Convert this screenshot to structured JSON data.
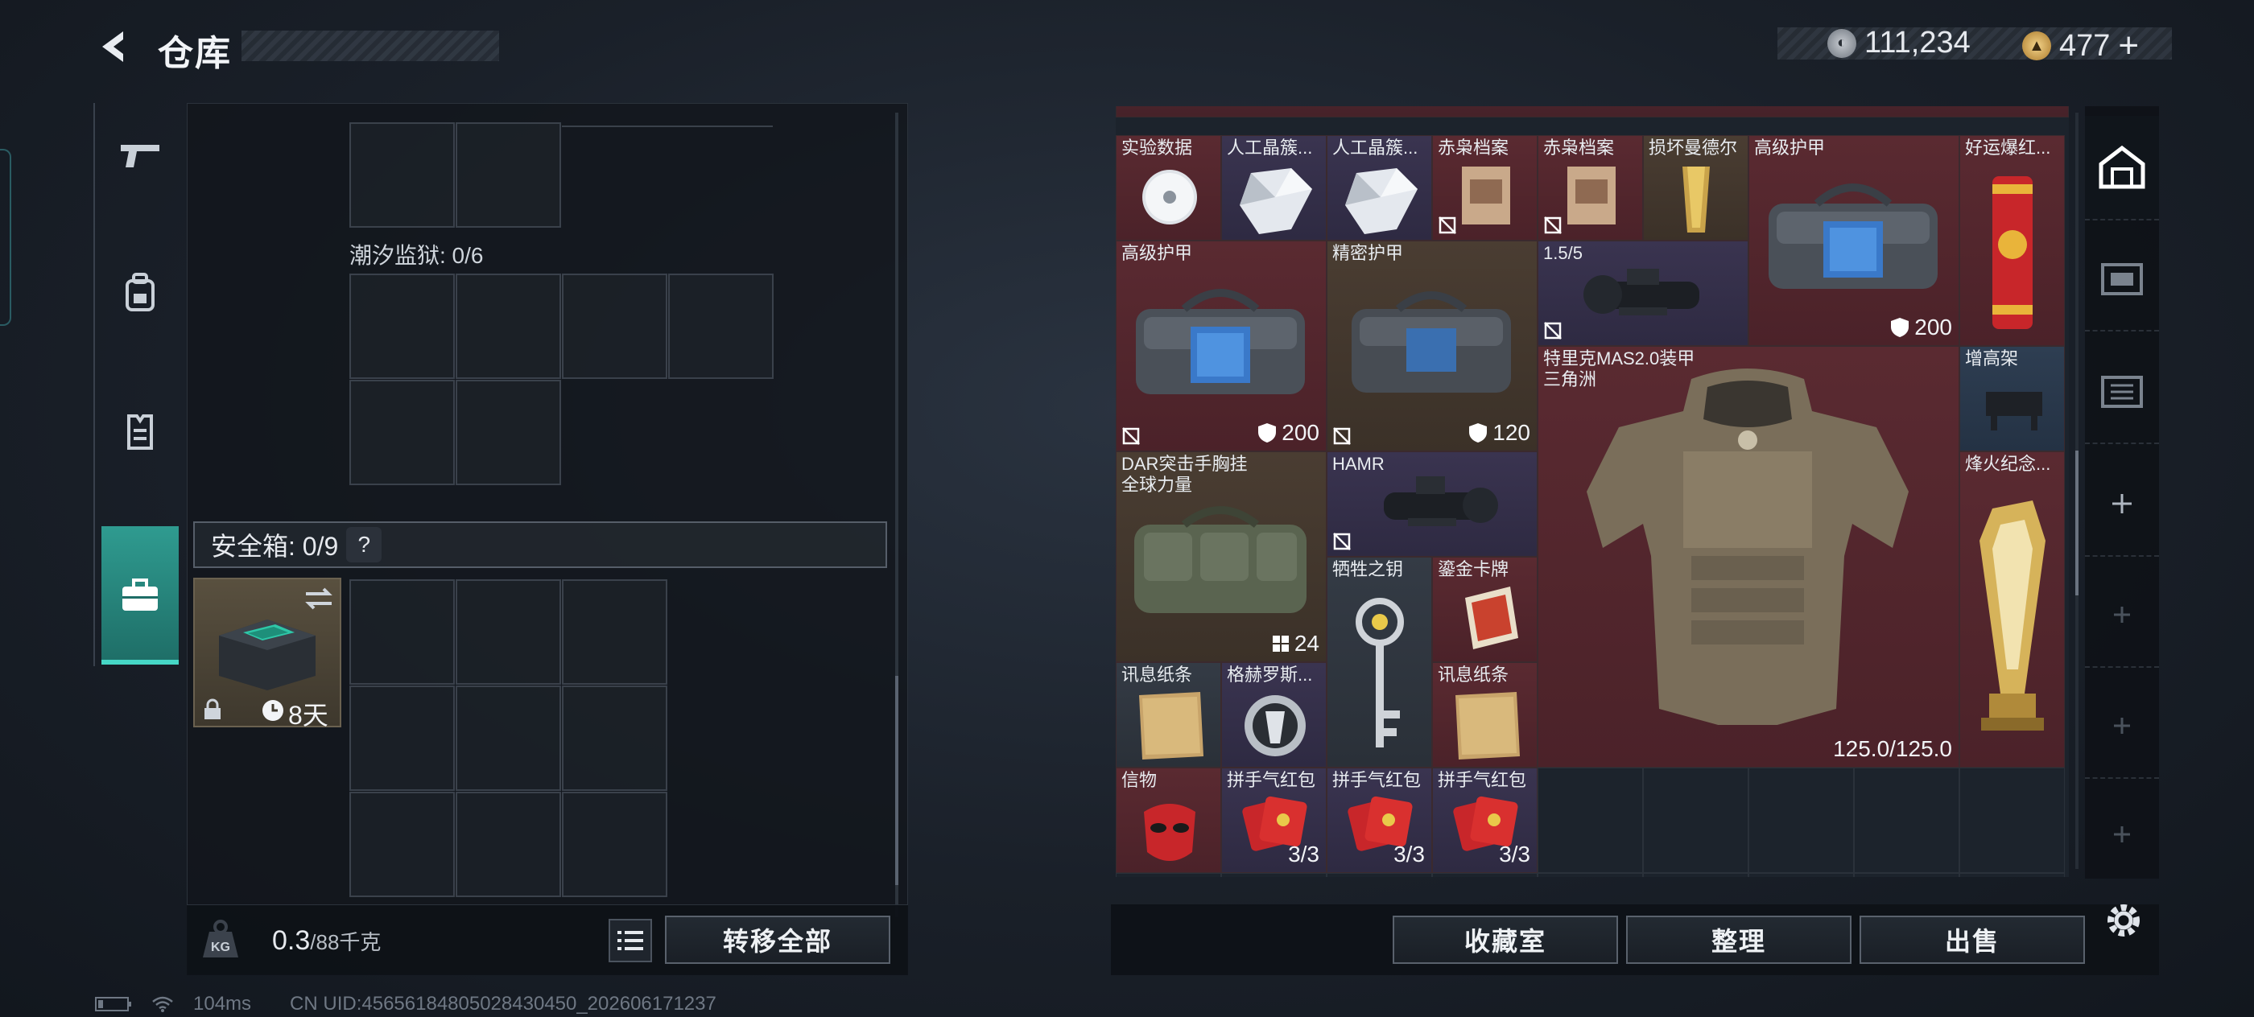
{
  "header": {
    "title": "仓库",
    "currency_silver": "111,234",
    "currency_gold": "477",
    "currency_add": "+"
  },
  "left_tabs": [
    {
      "name": "weapons",
      "icon": "gun-icon"
    },
    {
      "name": "gear",
      "icon": "backpack-icon"
    },
    {
      "name": "armor",
      "icon": "vest-icon"
    },
    {
      "name": "safe",
      "icon": "briefcase-icon",
      "active": true
    }
  ],
  "containers": {
    "tide_prison_label": "潮汐监狱: 0/6",
    "safe_label": "安全箱: 0/9",
    "safe_help": "?",
    "safe_time": "8天"
  },
  "weight": {
    "current": "0.3",
    "max": "/88千克"
  },
  "buttons": {
    "transfer_all": "转移全部",
    "collection": "收藏室",
    "organize": "整理",
    "sell": "出售"
  },
  "stash_items": {
    "exp_data": "实验数据",
    "crystal1": "人工晶簇...",
    "crystal2": "人工晶簇...",
    "archive1": "赤枭档案",
    "archive2": "赤枭档案",
    "damaged": "损坏曼德尔",
    "high_armor_top": "高级护甲",
    "high_armor_top_count": "200",
    "lucky": "好运爆红...",
    "high_armor2": "高级护甲",
    "high_armor2_count": "200",
    "precision_armor": "精密护甲",
    "precision_armor_count": "120",
    "scope_count": "1.5/5",
    "tellic_name": "特里克MAS2.0装甲",
    "tellic_sub": "三角洲",
    "tellic_durability": "125.0/125.0",
    "stand": "增高架",
    "dar_name": "DAR突击手胸挂",
    "dar_sub": "全球力量",
    "dar_count": "24",
    "hamr": "HAMR",
    "beacon": "烽火纪念...",
    "sacrifice_key": "牺牲之钥",
    "gold_card": "鎏金卡牌",
    "note1": "讯息纸条",
    "grech": "格赫罗斯...",
    "note2": "讯息纸条",
    "token": "信物",
    "red_packet": "拼手气红包",
    "red_packet_count": "3/3"
  },
  "status": {
    "ping": "104ms",
    "uid": "CN UID:45656184805028430450_202606171237"
  },
  "colors": {
    "accent": "#2f9b90",
    "item_red": "#5a2a31",
    "item_brown": "#4a3d32",
    "item_purple": "#3a3450"
  }
}
